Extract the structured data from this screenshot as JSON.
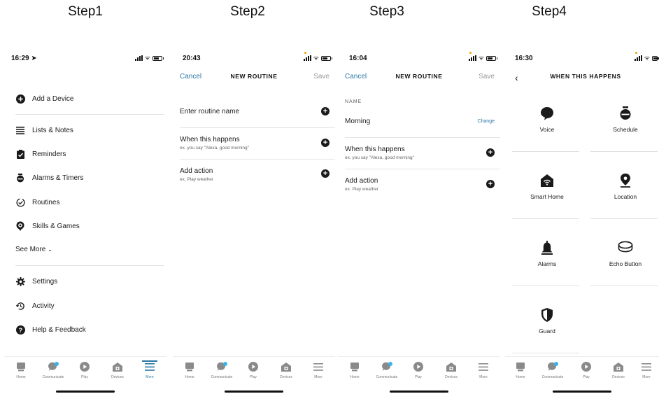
{
  "steps": [
    "Step1",
    "Step2",
    "Step3",
    "Step4"
  ],
  "step1": {
    "time": "16:29",
    "menu": [
      {
        "label": "Add a Device",
        "icon": "add-circle-icon"
      },
      {
        "label": "Lists & Notes",
        "icon": "list-icon"
      },
      {
        "label": "Reminders",
        "icon": "reminder-icon"
      },
      {
        "label": "Alarms & Timers",
        "icon": "alarm-icon"
      },
      {
        "label": "Routines",
        "icon": "routine-icon"
      },
      {
        "label": "Skills & Games",
        "icon": "skills-icon"
      }
    ],
    "see_more": "See More",
    "menu2": [
      {
        "label": "Settings",
        "icon": "gear-icon"
      },
      {
        "label": "Activity",
        "icon": "history-icon"
      },
      {
        "label": "Help & Feedback",
        "icon": "help-icon"
      }
    ]
  },
  "step2": {
    "time": "20:43",
    "cancel": "Cancel",
    "title": "NEW ROUTINE",
    "save": "Save",
    "routine_name": "Enter routine name",
    "when": "When this happens",
    "when_sub": "ex. you say \"Alexa, good morning\"",
    "action": "Add action",
    "action_sub": "ex. Play weather"
  },
  "step3": {
    "time": "16:04",
    "cancel": "Cancel",
    "title": "NEW ROUTINE",
    "save": "Save",
    "name_label": "NAME",
    "name_value": "Morning",
    "change": "Change",
    "when": "When this happens",
    "when_sub": "ex. you say \"Alexa, good morning\"",
    "action": "Add action",
    "action_sub": "ex. Play weather"
  },
  "step4": {
    "time": "16:30",
    "title": "WHEN THIS HAPPENS",
    "options": [
      {
        "label": "Voice",
        "icon": "voice-icon"
      },
      {
        "label": "Schedule",
        "icon": "schedule-icon"
      },
      {
        "label": "Smart Home",
        "icon": "smart-home-icon"
      },
      {
        "label": "Location",
        "icon": "location-icon"
      },
      {
        "label": "Alarms",
        "icon": "bell-icon"
      },
      {
        "label": "Echo Button",
        "icon": "echo-button-icon"
      },
      {
        "label": "Guard",
        "icon": "shield-icon"
      }
    ]
  },
  "bottom_nav": [
    {
      "label": "Home",
      "icon": "home-icon"
    },
    {
      "label": "Communicate",
      "icon": "chat-icon"
    },
    {
      "label": "Play",
      "icon": "play-icon"
    },
    {
      "label": "Devices",
      "icon": "devices-icon"
    },
    {
      "label": "More",
      "icon": "menu-icon"
    }
  ],
  "colors": {
    "accent": "#2a77a6",
    "text": "#1a1a1a",
    "badge": "#3ab4e8",
    "status_dot": "#f6a000"
  }
}
